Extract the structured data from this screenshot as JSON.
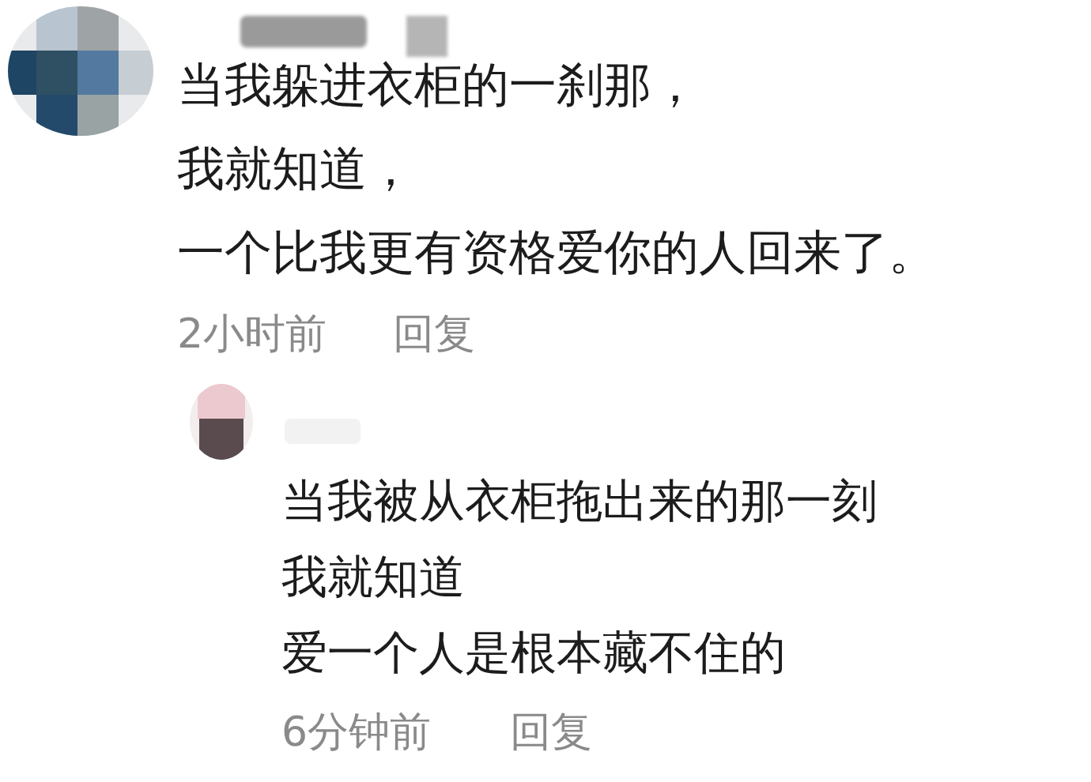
{
  "comments": [
    {
      "lines": [
        "当我躲进衣柜的一刹那，",
        "我就知道，",
        "一个比我更有资格爱你的人回来了。"
      ],
      "time": "2小时前",
      "reply": "回复",
      "kind": "comment"
    },
    {
      "lines": [
        "当我被从衣柜拖出来的那一刻",
        "我就知道",
        "爱一个人是根本藏不住的"
      ],
      "time": "6分钟前",
      "reply": "回复",
      "kind": "reply"
    }
  ]
}
